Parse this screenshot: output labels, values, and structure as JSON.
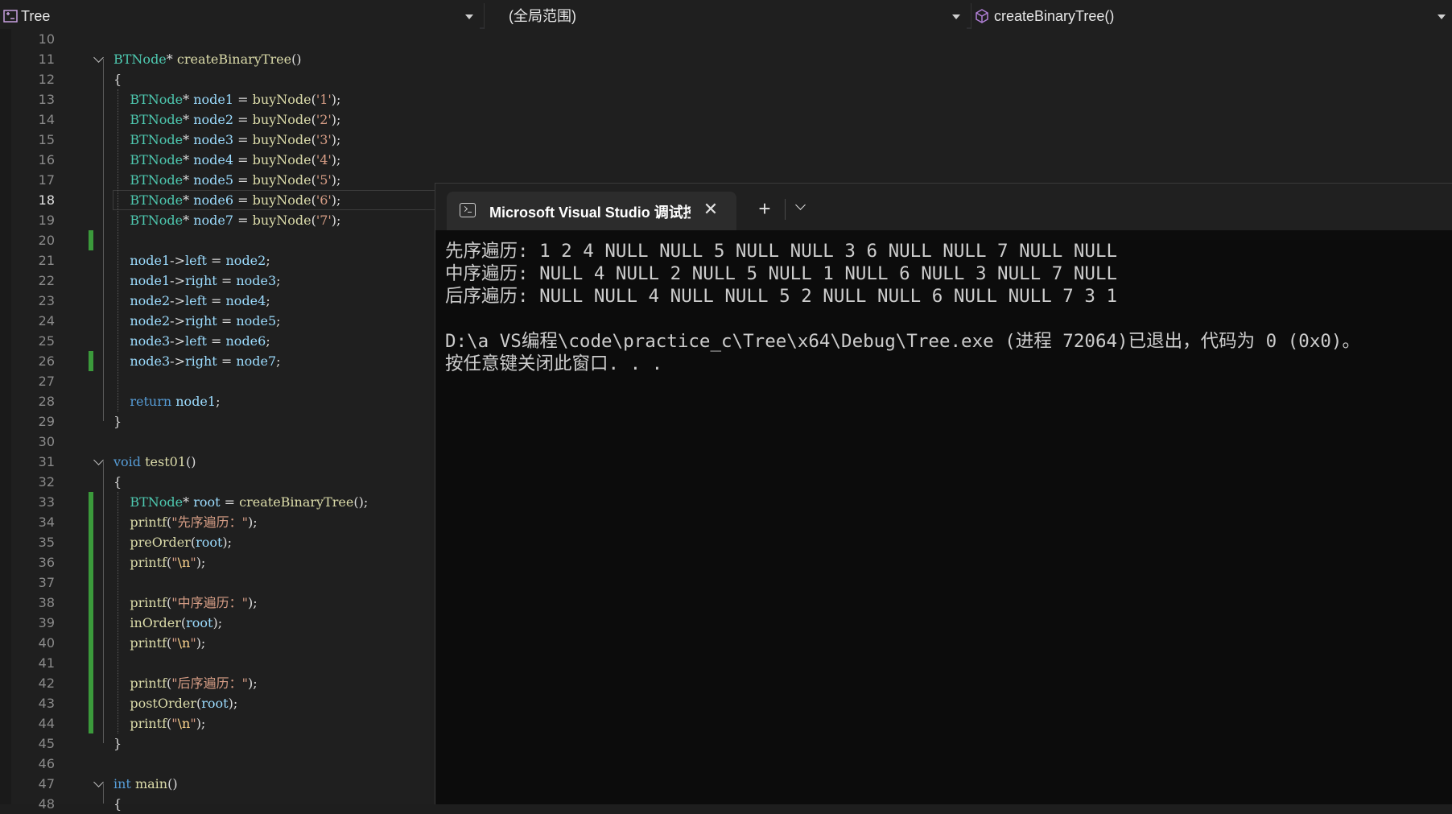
{
  "navbar": {
    "project": "Tree",
    "scope": "(全局范围)",
    "member": "createBinaryTree()"
  },
  "editor": {
    "current_line": "18",
    "lines": [
      {
        "n": "10",
        "code": []
      },
      {
        "n": "11",
        "code": [
          [
            "t",
            "BTNode"
          ],
          [
            "p",
            "* "
          ],
          [
            "f",
            "createBinaryTree"
          ],
          [
            "p",
            "()"
          ]
        ]
      },
      {
        "n": "12",
        "code": [
          [
            "p",
            "{"
          ]
        ]
      },
      {
        "n": "13",
        "code": [
          [
            "p",
            "    "
          ],
          [
            "t",
            "BTNode"
          ],
          [
            "p",
            "* "
          ],
          [
            "v",
            "node1"
          ],
          [
            "p",
            " = "
          ],
          [
            "f",
            "buyNode"
          ],
          [
            "p",
            "("
          ],
          [
            "s",
            "'1'"
          ],
          [
            "p",
            ");"
          ]
        ]
      },
      {
        "n": "14",
        "code": [
          [
            "p",
            "    "
          ],
          [
            "t",
            "BTNode"
          ],
          [
            "p",
            "* "
          ],
          [
            "v",
            "node2"
          ],
          [
            "p",
            " = "
          ],
          [
            "f",
            "buyNode"
          ],
          [
            "p",
            "("
          ],
          [
            "s",
            "'2'"
          ],
          [
            "p",
            ");"
          ]
        ]
      },
      {
        "n": "15",
        "code": [
          [
            "p",
            "    "
          ],
          [
            "t",
            "BTNode"
          ],
          [
            "p",
            "* "
          ],
          [
            "v",
            "node3"
          ],
          [
            "p",
            " = "
          ],
          [
            "f",
            "buyNode"
          ],
          [
            "p",
            "("
          ],
          [
            "s",
            "'3'"
          ],
          [
            "p",
            ");"
          ]
        ]
      },
      {
        "n": "16",
        "code": [
          [
            "p",
            "    "
          ],
          [
            "t",
            "BTNode"
          ],
          [
            "p",
            "* "
          ],
          [
            "v",
            "node4"
          ],
          [
            "p",
            " = "
          ],
          [
            "f",
            "buyNode"
          ],
          [
            "p",
            "("
          ],
          [
            "s",
            "'4'"
          ],
          [
            "p",
            ");"
          ]
        ]
      },
      {
        "n": "17",
        "code": [
          [
            "p",
            "    "
          ],
          [
            "t",
            "BTNode"
          ],
          [
            "p",
            "* "
          ],
          [
            "v",
            "node5"
          ],
          [
            "p",
            " = "
          ],
          [
            "f",
            "buyNode"
          ],
          [
            "p",
            "("
          ],
          [
            "s",
            "'5'"
          ],
          [
            "p",
            ");"
          ]
        ]
      },
      {
        "n": "18",
        "code": [
          [
            "p",
            "    "
          ],
          [
            "t",
            "BTNode"
          ],
          [
            "p",
            "* "
          ],
          [
            "v",
            "node6"
          ],
          [
            "p",
            " = "
          ],
          [
            "f",
            "buyNode"
          ],
          [
            "p",
            "("
          ],
          [
            "s",
            "'6'"
          ],
          [
            "p",
            ");"
          ]
        ]
      },
      {
        "n": "19",
        "code": [
          [
            "p",
            "    "
          ],
          [
            "t",
            "BTNode"
          ],
          [
            "p",
            "* "
          ],
          [
            "v",
            "node7"
          ],
          [
            "p",
            " = "
          ],
          [
            "f",
            "buyNode"
          ],
          [
            "p",
            "("
          ],
          [
            "s",
            "'7'"
          ],
          [
            "p",
            ");"
          ]
        ]
      },
      {
        "n": "20",
        "code": []
      },
      {
        "n": "21",
        "code": [
          [
            "p",
            "    "
          ],
          [
            "v",
            "node1"
          ],
          [
            "p",
            "->"
          ],
          [
            "v",
            "left"
          ],
          [
            "p",
            " = "
          ],
          [
            "v",
            "node2"
          ],
          [
            "p",
            ";"
          ]
        ]
      },
      {
        "n": "22",
        "code": [
          [
            "p",
            "    "
          ],
          [
            "v",
            "node1"
          ],
          [
            "p",
            "->"
          ],
          [
            "v",
            "right"
          ],
          [
            "p",
            " = "
          ],
          [
            "v",
            "node3"
          ],
          [
            "p",
            ";"
          ]
        ]
      },
      {
        "n": "23",
        "code": [
          [
            "p",
            "    "
          ],
          [
            "v",
            "node2"
          ],
          [
            "p",
            "->"
          ],
          [
            "v",
            "left"
          ],
          [
            "p",
            " = "
          ],
          [
            "v",
            "node4"
          ],
          [
            "p",
            ";"
          ]
        ]
      },
      {
        "n": "24",
        "code": [
          [
            "p",
            "    "
          ],
          [
            "v",
            "node2"
          ],
          [
            "p",
            "->"
          ],
          [
            "v",
            "right"
          ],
          [
            "p",
            " = "
          ],
          [
            "v",
            "node5"
          ],
          [
            "p",
            ";"
          ]
        ]
      },
      {
        "n": "25",
        "code": [
          [
            "p",
            "    "
          ],
          [
            "v",
            "node3"
          ],
          [
            "p",
            "->"
          ],
          [
            "v",
            "left"
          ],
          [
            "p",
            " = "
          ],
          [
            "v",
            "node6"
          ],
          [
            "p",
            ";"
          ]
        ]
      },
      {
        "n": "26",
        "code": [
          [
            "p",
            "    "
          ],
          [
            "v",
            "node3"
          ],
          [
            "p",
            "->"
          ],
          [
            "v",
            "right"
          ],
          [
            "p",
            " = "
          ],
          [
            "v",
            "node7"
          ],
          [
            "p",
            ";"
          ]
        ]
      },
      {
        "n": "27",
        "code": []
      },
      {
        "n": "28",
        "code": [
          [
            "p",
            "    "
          ],
          [
            "k",
            "return"
          ],
          [
            "p",
            " "
          ],
          [
            "v",
            "node1"
          ],
          [
            "p",
            ";"
          ]
        ]
      },
      {
        "n": "29",
        "code": [
          [
            "p",
            "}"
          ]
        ]
      },
      {
        "n": "30",
        "code": []
      },
      {
        "n": "31",
        "code": [
          [
            "k",
            "void"
          ],
          [
            "p",
            " "
          ],
          [
            "f",
            "test01"
          ],
          [
            "p",
            "()"
          ]
        ]
      },
      {
        "n": "32",
        "code": [
          [
            "p",
            "{"
          ]
        ]
      },
      {
        "n": "33",
        "code": [
          [
            "p",
            "    "
          ],
          [
            "t",
            "BTNode"
          ],
          [
            "p",
            "* "
          ],
          [
            "v",
            "root"
          ],
          [
            "p",
            " = "
          ],
          [
            "f",
            "createBinaryTree"
          ],
          [
            "p",
            "();"
          ]
        ]
      },
      {
        "n": "34",
        "code": [
          [
            "p",
            "    "
          ],
          [
            "f",
            "printf"
          ],
          [
            "p",
            "("
          ],
          [
            "s",
            "\"先序遍历：\""
          ],
          [
            "p",
            ");"
          ]
        ]
      },
      {
        "n": "35",
        "code": [
          [
            "p",
            "    "
          ],
          [
            "f",
            "preOrder"
          ],
          [
            "p",
            "("
          ],
          [
            "v",
            "root"
          ],
          [
            "p",
            ");"
          ]
        ]
      },
      {
        "n": "36",
        "code": [
          [
            "p",
            "    "
          ],
          [
            "f",
            "printf"
          ],
          [
            "p",
            "("
          ],
          [
            "s",
            "\""
          ],
          [
            "esc",
            "\\n"
          ],
          [
            "s",
            "\""
          ],
          [
            "p",
            ");"
          ]
        ]
      },
      {
        "n": "37",
        "code": []
      },
      {
        "n": "38",
        "code": [
          [
            "p",
            "    "
          ],
          [
            "f",
            "printf"
          ],
          [
            "p",
            "("
          ],
          [
            "s",
            "\"中序遍历：\""
          ],
          [
            "p",
            ");"
          ]
        ]
      },
      {
        "n": "39",
        "code": [
          [
            "p",
            "    "
          ],
          [
            "f",
            "inOrder"
          ],
          [
            "p",
            "("
          ],
          [
            "v",
            "root"
          ],
          [
            "p",
            ");"
          ]
        ]
      },
      {
        "n": "40",
        "code": [
          [
            "p",
            "    "
          ],
          [
            "f",
            "printf"
          ],
          [
            "p",
            "("
          ],
          [
            "s",
            "\""
          ],
          [
            "esc",
            "\\n"
          ],
          [
            "s",
            "\""
          ],
          [
            "p",
            ");"
          ]
        ]
      },
      {
        "n": "41",
        "code": []
      },
      {
        "n": "42",
        "code": [
          [
            "p",
            "    "
          ],
          [
            "f",
            "printf"
          ],
          [
            "p",
            "("
          ],
          [
            "s",
            "\"后序遍历：\""
          ],
          [
            "p",
            ");"
          ]
        ]
      },
      {
        "n": "43",
        "code": [
          [
            "p",
            "    "
          ],
          [
            "f",
            "postOrder"
          ],
          [
            "p",
            "("
          ],
          [
            "v",
            "root"
          ],
          [
            "p",
            ");"
          ]
        ]
      },
      {
        "n": "44",
        "code": [
          [
            "p",
            "    "
          ],
          [
            "f",
            "printf"
          ],
          [
            "p",
            "("
          ],
          [
            "s",
            "\""
          ],
          [
            "esc",
            "\\n"
          ],
          [
            "s",
            "\""
          ],
          [
            "p",
            ");"
          ]
        ]
      },
      {
        "n": "45",
        "code": [
          [
            "p",
            "}"
          ]
        ]
      },
      {
        "n": "46",
        "code": []
      },
      {
        "n": "47",
        "code": [
          [
            "k",
            "int"
          ],
          [
            "p",
            " "
          ],
          [
            "f",
            "main"
          ],
          [
            "p",
            "()"
          ]
        ]
      },
      {
        "n": "48",
        "code": [
          [
            "p",
            "{"
          ]
        ]
      }
    ],
    "fold_lines": [
      "11",
      "31",
      "47"
    ],
    "changed_lines": [
      "20",
      "26",
      "33",
      "34",
      "35",
      "36",
      "37",
      "38",
      "39",
      "40",
      "41",
      "42",
      "43",
      "44"
    ]
  },
  "terminal": {
    "tab_title": "Microsoft Visual Studio 调试控制台",
    "output": [
      "先序遍历: 1 2 4 NULL NULL 5 NULL NULL 3 6 NULL NULL 7 NULL NULL",
      "中序遍历: NULL 4 NULL 2 NULL 5 NULL 1 NULL 6 NULL 3 NULL 7 NULL",
      "后序遍历: NULL NULL 4 NULL NULL 5 2 NULL NULL 6 NULL NULL 7 3 1",
      "",
      "D:\\a VS编程\\code\\practice_c\\Tree\\x64\\Debug\\Tree.exe (进程 72064)已退出，代码为 0 (0x0)。",
      "按任意键关闭此窗口. . ."
    ]
  },
  "colors": {
    "keyword": "#569cd6",
    "type": "#4ec9b0",
    "function": "#dcdcaa",
    "variable": "#9cdcfe",
    "string": "#d69d85",
    "change_bar": "#3b9a3b"
  },
  "icons": {
    "project": "project-icon",
    "member": "member-cube-icon",
    "terminal": "console-icon",
    "close": "close-icon",
    "new_tab": "plus-icon",
    "menu": "chevron-down-icon"
  }
}
